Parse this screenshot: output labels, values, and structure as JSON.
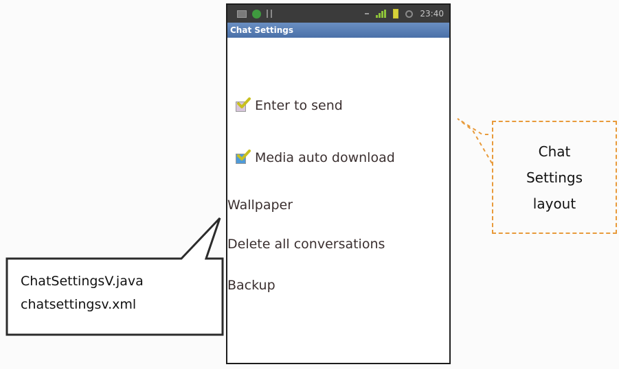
{
  "statusbar": {
    "time": "23:40",
    "icons": [
      "message-icon",
      "whatsapp-icon",
      "usb-icon",
      "signal-icon",
      "battery-icon",
      "alarm-icon"
    ]
  },
  "screen": {
    "title": "Chat Settings",
    "checkbox_items": [
      {
        "label": "Enter to send",
        "checked": true,
        "box_color": "#d8c6dc"
      },
      {
        "label": "Media auto download",
        "checked": true,
        "box_color": "#4f9ad8"
      }
    ],
    "list_items": [
      {
        "label": "Wallpaper"
      },
      {
        "label": "Delete all conversations"
      },
      {
        "label": "Backup"
      }
    ]
  },
  "left_callout": {
    "lines": [
      "ChatSettingsV.java",
      "chatsettingsv.xml"
    ]
  },
  "right_annotation": {
    "lines": [
      "Chat",
      "Settings",
      "layout"
    ],
    "color": "#e89a3a"
  }
}
